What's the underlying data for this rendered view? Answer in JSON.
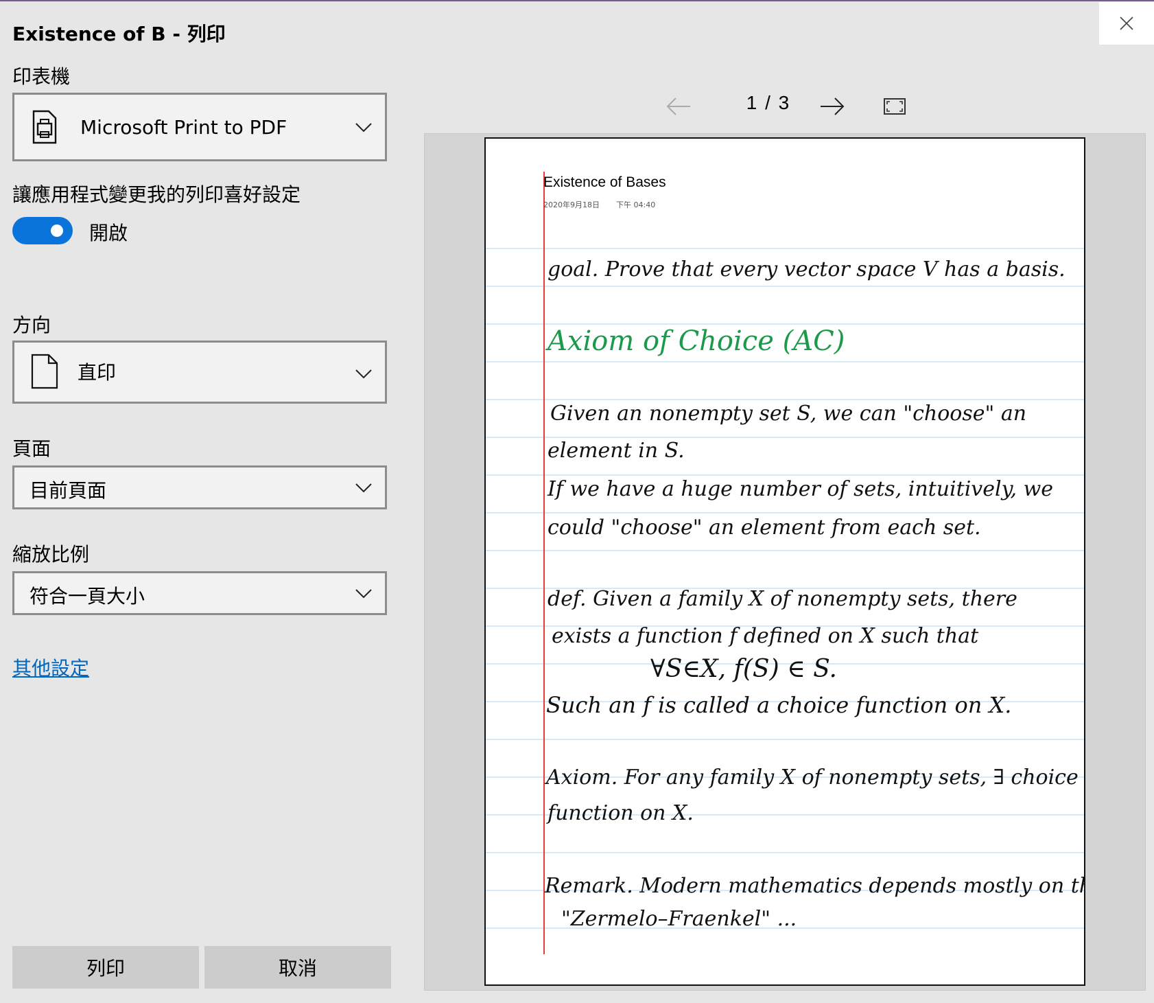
{
  "window": {
    "title": "Existence of B - 列印"
  },
  "printer": {
    "label": "印表機",
    "value": "Microsoft Print to PDF"
  },
  "app_prefs": {
    "label": "讓應用程式變更我的列印喜好設定",
    "toggle_state": "開啟",
    "toggle_on": true
  },
  "orientation": {
    "label": "方向",
    "value": "直印"
  },
  "pages": {
    "label": "頁面",
    "value": "目前頁面"
  },
  "scale": {
    "label": "縮放比例",
    "value": "符合一頁大小"
  },
  "more_settings": "其他設定",
  "buttons": {
    "print": "列印",
    "cancel": "取消"
  },
  "preview": {
    "current_page": "1",
    "separator": "/",
    "total_pages": "3",
    "page_indicator": "1  /  3"
  },
  "note": {
    "title": "Existence of Bases",
    "date": "2020年9月18日",
    "time": "下午 04:40",
    "lines": [
      "goal. Prove that every vector space V has a basis.",
      "Axiom of Choice (AC)",
      "Given an nonempty set S, we can \"choose\" an",
      "element in S.",
      "If we have a huge number of sets, intuitively, we",
      "could \"choose\" an element from each set.",
      "def. Given a family X of nonempty sets, there",
      "exists a function f defined on X such that",
      "∀S∈X,   f(S) ∈ S.",
      "Such an f is called a choice function on X.",
      "Axiom. For any family X of nonempty sets, ∃ choice",
      "function on X.",
      "Remark. Modern mathematics depends mostly on the",
      "\"Zermelo–Fraenkel\" ..."
    ]
  },
  "colors": {
    "accent": "#0a74da",
    "link": "#0067c0",
    "note_green": "#1a9a4a",
    "margin_red": "#e83a3a",
    "rule_blue": "#c8e4f4"
  }
}
